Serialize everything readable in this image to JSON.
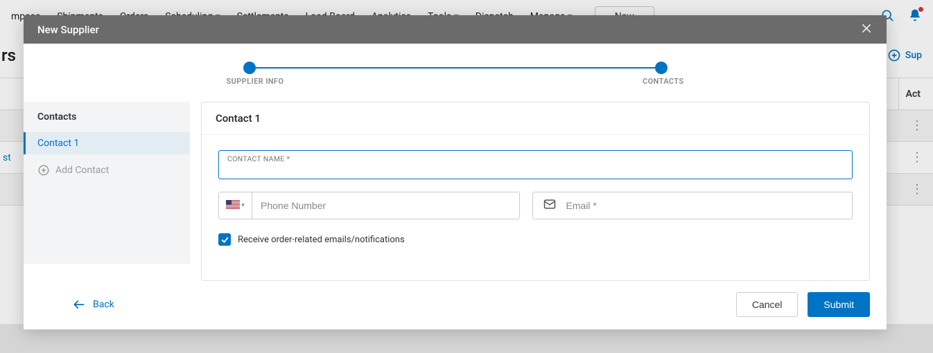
{
  "bg": {
    "brand_partial": "mpass",
    "nav": [
      "Shipments",
      "Orders",
      "Scheduling",
      "Settlements",
      "Load Board",
      "Analytics",
      "Tools",
      "Dispatch",
      "Manage"
    ],
    "new_btn": "New",
    "page_title_partial": "rs",
    "sup_link": "Sup",
    "actions_col": "Act",
    "st_text": "st"
  },
  "modal": {
    "title": "New Supplier",
    "stepper": {
      "left": "SUPPLIER INFO",
      "right": "CONTACTS"
    },
    "sidebar": {
      "title": "Contacts",
      "item": "Contact 1",
      "add": "Add Contact"
    },
    "content": {
      "header": "Contact 1",
      "name_label": "CONTACT NAME *",
      "phone_placeholder": "Phone Number",
      "email_placeholder": "Email *",
      "checkbox_label": "Receive order-related emails/notifications"
    },
    "footer": {
      "back": "Back",
      "cancel": "Cancel",
      "submit": "Submit"
    }
  }
}
